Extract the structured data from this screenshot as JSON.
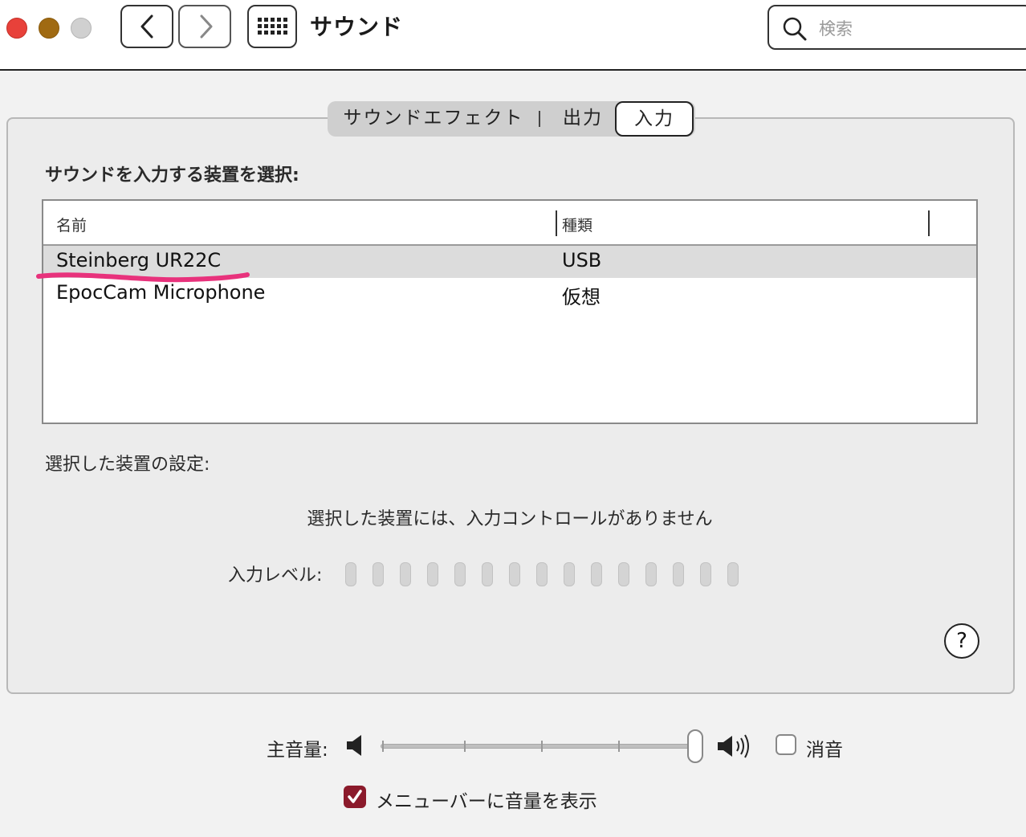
{
  "window": {
    "title": "サウンド"
  },
  "toolbar": {
    "search_placeholder": "検索"
  },
  "tabs": [
    {
      "label": "サウンドエフェクト"
    },
    {
      "label": "出力"
    },
    {
      "label": "入力",
      "selected": true
    }
  ],
  "input_pane": {
    "section_label": "サウンドを入力する装置を選択:",
    "table": {
      "columns": [
        "名前",
        "種類"
      ],
      "rows": [
        {
          "name": "Steinberg UR22C",
          "type": "USB",
          "selected": true
        },
        {
          "name": "EpocCam Microphone",
          "type": "仮想",
          "selected": false
        }
      ]
    },
    "settings_label": "選択した装置の設定:",
    "no_controls_text": "選択した装置には、入力コントロールがありません",
    "input_level_label": "入力レベル:",
    "input_level_segments": 15,
    "input_level_lit": 0,
    "help_label": "?"
  },
  "footer": {
    "volume_label": "主音量:",
    "volume_level": 1.0,
    "mute_label": "消音",
    "mute_checked": false,
    "show_in_menubar_label": "メニューバーに音量を表示",
    "show_in_menubar_checked": true
  },
  "colors": {
    "close": "#e8413a",
    "minimize": "#a06a12",
    "checkbox_accent": "#8b1a2b",
    "annotation": "#e8327c"
  }
}
